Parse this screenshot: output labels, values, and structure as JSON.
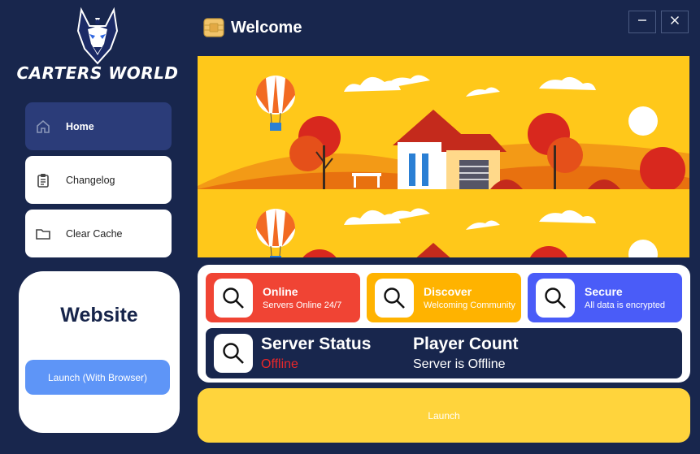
{
  "sidebar": {
    "brand": "CARTERS WORLD",
    "items": [
      {
        "label": "Home",
        "icon": "home-icon",
        "active": true
      },
      {
        "label": "Changelog",
        "icon": "clipboard-icon",
        "active": false
      },
      {
        "label": "Clear Cache",
        "icon": "folder-icon",
        "active": false
      }
    ],
    "website": {
      "title": "Website",
      "button_label": "Launch (With Browser)"
    }
  },
  "header": {
    "title": "Welcome",
    "icon": "chip-icon",
    "minimize_label": "—",
    "close_label": "✕"
  },
  "tiles": [
    {
      "title": "Online",
      "subtitle": "Servers Online 24/7",
      "color": "#f04434",
      "icon": "search-icon"
    },
    {
      "title": "Discover",
      "subtitle": "Welcoming Community",
      "color": "#ffb300",
      "icon": "search-icon"
    },
    {
      "title": "Secure",
      "subtitle": "All data is encrypted",
      "color": "#4a5cf8",
      "icon": "search-icon"
    }
  ],
  "status": {
    "server_status_label": "Server Status",
    "server_status_value": "Offline",
    "server_status_color": "#e8272a",
    "player_count_label": "Player Count",
    "player_count_value": "Server is Offline"
  },
  "launch_label": "Launch",
  "colors": {
    "background": "#18264d",
    "active_nav": "#2b3c79",
    "website_button": "#5e95f7",
    "launch_button": "#ffd43c",
    "banner_yellow": "#ffc81a"
  }
}
